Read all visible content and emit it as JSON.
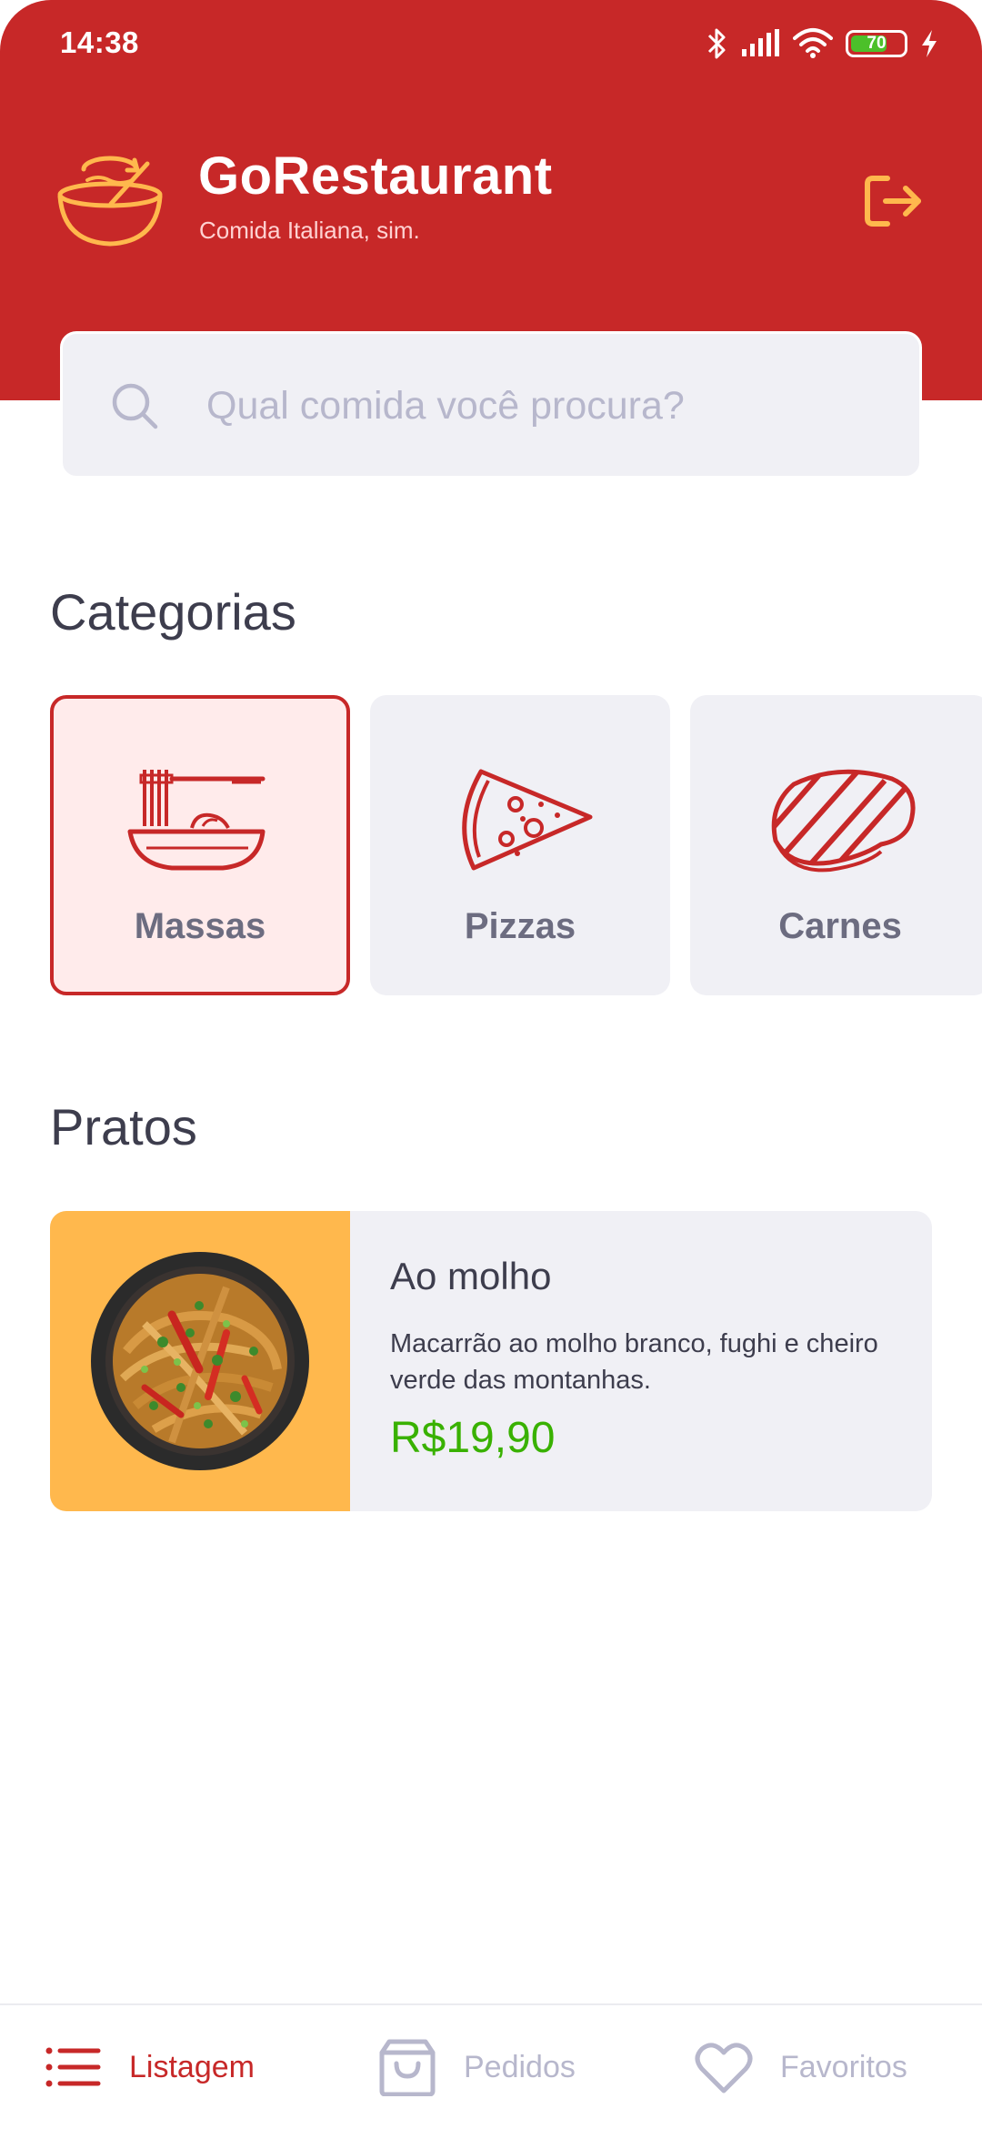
{
  "statusbar": {
    "time": "14:38",
    "battery": "70"
  },
  "header": {
    "title": "GoRestaurant",
    "subtitle": "Comida Italiana, sim."
  },
  "search": {
    "placeholder": "Qual comida você procura?"
  },
  "categories": {
    "title": "Categorias",
    "items": [
      {
        "label": "Massas",
        "icon": "pasta-icon",
        "selected": true
      },
      {
        "label": "Pizzas",
        "icon": "pizza-icon",
        "selected": false
      },
      {
        "label": "Carnes",
        "icon": "steak-icon",
        "selected": false
      }
    ]
  },
  "dishes": {
    "title": "Pratos",
    "items": [
      {
        "name": "Ao molho",
        "description": "Macarrão ao molho branco, fughi e cheiro verde das montanhas.",
        "price": "R$19,90"
      }
    ]
  },
  "tabbar": {
    "items": [
      {
        "label": "Listagem",
        "icon": "list-icon",
        "active": true
      },
      {
        "label": "Pedidos",
        "icon": "shopping-bag-icon",
        "active": false
      },
      {
        "label": "Favoritos",
        "icon": "heart-icon",
        "active": false
      }
    ]
  },
  "colors": {
    "primary": "#c72828",
    "accent": "#ffb84d",
    "price": "#39b100",
    "card": "#f0f0f5"
  }
}
